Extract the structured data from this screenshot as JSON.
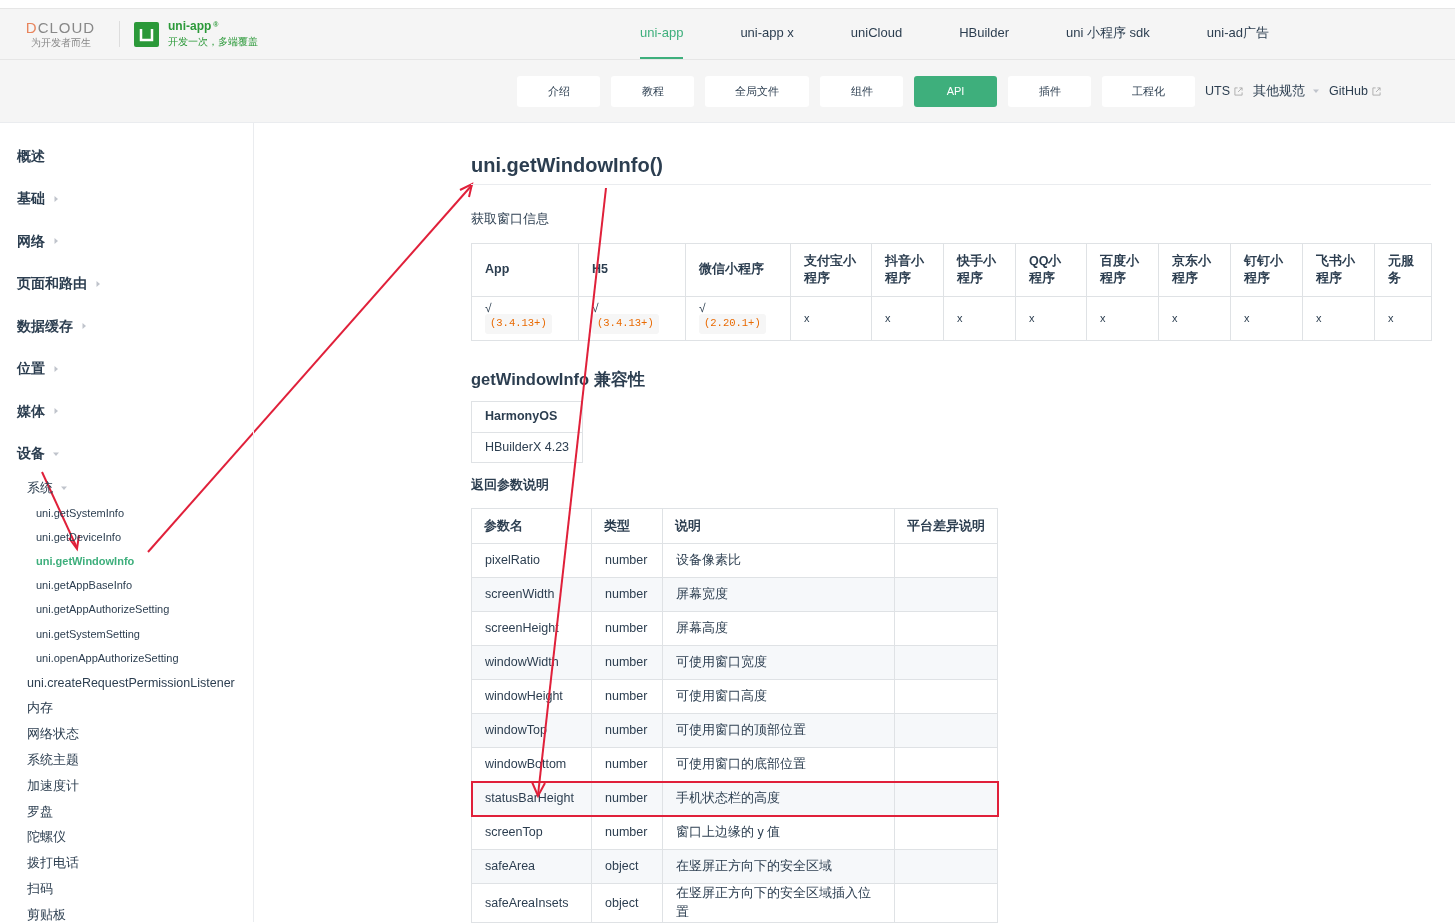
{
  "logo": {
    "wordmark": "DCLOUD",
    "tagline": "为开发者而生"
  },
  "product": {
    "name": "uni-app",
    "mark": "®",
    "slogan": "开发一次，多端覆盖"
  },
  "top_nav": [
    {
      "label": "uni-app",
      "selected": true
    },
    {
      "label": "uni-app x",
      "selected": false
    },
    {
      "label": "uniCloud",
      "selected": false
    },
    {
      "label": "HBuilder",
      "selected": false
    },
    {
      "label": "uni 小程序 sdk",
      "selected": false
    },
    {
      "label": "uni-ad广告",
      "selected": false
    }
  ],
  "sub_nav": [
    {
      "label": "介绍",
      "kind": "button",
      "selected": false
    },
    {
      "label": "教程",
      "kind": "button",
      "selected": false
    },
    {
      "label": "全局文件",
      "kind": "button",
      "selected": false
    },
    {
      "label": "组件",
      "kind": "button",
      "selected": false
    },
    {
      "label": "API",
      "kind": "button",
      "selected": true
    },
    {
      "label": "插件",
      "kind": "button",
      "selected": false
    },
    {
      "label": "工程化",
      "kind": "button",
      "selected": false
    },
    {
      "label": "UTS",
      "kind": "external",
      "selected": false
    },
    {
      "label": "其他规范",
      "kind": "dropdown",
      "selected": false
    },
    {
      "label": "GitHub",
      "kind": "external",
      "selected": false
    }
  ],
  "sidebar": {
    "items": [
      {
        "label": "概述",
        "kind": "leaf",
        "selected": false
      },
      {
        "label": "基础",
        "kind": "group",
        "expanded": false,
        "selected": false
      },
      {
        "label": "网络",
        "kind": "group",
        "expanded": false,
        "selected": false
      },
      {
        "label": "页面和路由",
        "kind": "group",
        "expanded": false,
        "selected": false
      },
      {
        "label": "数据缓存",
        "kind": "group",
        "expanded": false,
        "selected": false
      },
      {
        "label": "位置",
        "kind": "group",
        "expanded": false,
        "selected": false
      },
      {
        "label": "媒体",
        "kind": "group",
        "expanded": false,
        "selected": false
      },
      {
        "label": "设备",
        "kind": "group",
        "expanded": true,
        "selected": false,
        "children": [
          {
            "label": "系统",
            "kind": "group",
            "expanded": true,
            "selected": false,
            "children": [
              {
                "label": "uni.getSystemInfo",
                "kind": "leaf",
                "selected": false
              },
              {
                "label": "uni.getDeviceInfo",
                "kind": "leaf",
                "selected": false
              },
              {
                "label": "uni.getWindowInfo",
                "kind": "leaf",
                "selected": true
              },
              {
                "label": "uni.getAppBaseInfo",
                "kind": "leaf",
                "selected": false
              },
              {
                "label": "uni.getAppAuthorizeSetting",
                "kind": "leaf",
                "selected": false
              },
              {
                "label": "uni.getSystemSetting",
                "kind": "leaf",
                "selected": false
              },
              {
                "label": "uni.openAppAuthorizeSetting",
                "kind": "leaf",
                "selected": false
              }
            ]
          },
          {
            "label": "uni.createRequestPermissionListener",
            "kind": "leaf",
            "selected": false
          },
          {
            "label": "内存",
            "kind": "leaf",
            "selected": false
          },
          {
            "label": "网络状态",
            "kind": "leaf",
            "selected": false
          },
          {
            "label": "系统主题",
            "kind": "leaf",
            "selected": false
          },
          {
            "label": "加速度计",
            "kind": "leaf",
            "selected": false
          },
          {
            "label": "罗盘",
            "kind": "leaf",
            "selected": false
          },
          {
            "label": "陀螺仪",
            "kind": "leaf",
            "selected": false
          },
          {
            "label": "拨打电话",
            "kind": "leaf",
            "selected": false
          },
          {
            "label": "扫码",
            "kind": "leaf",
            "selected": false
          },
          {
            "label": "剪贴板",
            "kind": "leaf",
            "selected": false
          }
        ]
      }
    ]
  },
  "title": "uni.getWindowInfo()",
  "description": "获取窗口信息",
  "platform_table": {
    "columns": [
      "App",
      "H5",
      "微信小程序",
      "支付宝小程序",
      "抖音小程序",
      "快手小程序",
      "QQ小程序",
      "百度小程序",
      "京东小程序",
      "钉钉小程序",
      "飞书小程序",
      "元服务"
    ],
    "row": [
      {
        "mark": "√",
        "version": "(3.4.13+)"
      },
      {
        "mark": "√",
        "version": "(3.4.13+)"
      },
      {
        "mark": "√",
        "version": "(2.20.1+)"
      },
      {
        "mark": "x"
      },
      {
        "mark": "x"
      },
      {
        "mark": "x"
      },
      {
        "mark": "x"
      },
      {
        "mark": "x"
      },
      {
        "mark": "x"
      },
      {
        "mark": "x"
      },
      {
        "mark": "x"
      },
      {
        "mark": "x"
      }
    ]
  },
  "compat_heading": "getWindowInfo 兼容性",
  "compat_table": {
    "columns": [
      "HarmonyOS"
    ],
    "rows": [
      [
        "HBuilderX 4.23"
      ]
    ]
  },
  "params_heading": "返回参数说明",
  "params_table": {
    "columns": [
      "参数名",
      "类型",
      "说明",
      "平台差异说明"
    ],
    "rows": [
      {
        "cells": [
          "pixelRatio",
          "number",
          "设备像素比"
        ],
        "highlighted": false
      },
      {
        "cells": [
          "screenWidth",
          "number",
          "屏幕宽度"
        ],
        "highlighted": false
      },
      {
        "cells": [
          "screenHeight",
          "number",
          "屏幕高度"
        ],
        "highlighted": false
      },
      {
        "cells": [
          "windowWidth",
          "number",
          "可使用窗口宽度"
        ],
        "highlighted": false
      },
      {
        "cells": [
          "windowHeight",
          "number",
          "可使用窗口高度"
        ],
        "highlighted": false
      },
      {
        "cells": [
          "windowTop",
          "number",
          "可使用窗口的顶部位置"
        ],
        "highlighted": false
      },
      {
        "cells": [
          "windowBottom",
          "number",
          "可使用窗口的底部位置"
        ],
        "highlighted": false
      },
      {
        "cells": [
          "statusBarHeight",
          "number",
          "手机状态栏的高度"
        ],
        "highlighted": true
      },
      {
        "cells": [
          "screenTop",
          "number",
          "窗口上边缘的 y 值"
        ],
        "highlighted": false
      },
      {
        "cells": [
          "safeArea",
          "object",
          "在竖屏正方向下的安全区域"
        ],
        "highlighted": false
      },
      {
        "cells": [
          "safeAreaInsets",
          "object",
          "在竖屏正方向下的安全区域插入位置"
        ],
        "highlighted": false
      }
    ]
  }
}
